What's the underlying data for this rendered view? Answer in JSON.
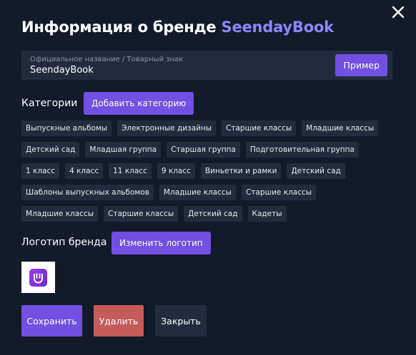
{
  "header": {
    "title_prefix": "Информация о бренде",
    "brand_name": "SeendayBook"
  },
  "name_field": {
    "label": "Официальное название / Товарный знак",
    "value": "SeendayBook",
    "example_button": "Пример"
  },
  "categories": {
    "label": "Категории",
    "add_button": "Добавить категорию",
    "items": [
      "Выпускные альбомы",
      "Электронные дизайны",
      "Старшие классы",
      "Младшие классы",
      "Детский сад",
      "Младшая группа",
      "Старшая группа",
      "Подготовительная группа",
      "1 класс",
      "4 класс",
      "11 класс",
      "9 класс",
      "Виньетки и рамки",
      "Детский сад",
      "Шаблоны выпускных альбомов",
      "Младшие классы",
      "Старшие классы",
      "Младшие классы",
      "Старшие классы",
      "Детский сад",
      "Кадеты"
    ]
  },
  "logo": {
    "label": "Логотип бренда",
    "change_button": "Изменить логотип"
  },
  "actions": {
    "save": "Сохранить",
    "delete": "Удалить",
    "close": "Закрыть"
  },
  "colors": {
    "background": "#131a2a",
    "accent": "#7150e2",
    "brand_text": "#8f86ff",
    "danger": "#c55b5b",
    "chip": "#232c3e"
  }
}
